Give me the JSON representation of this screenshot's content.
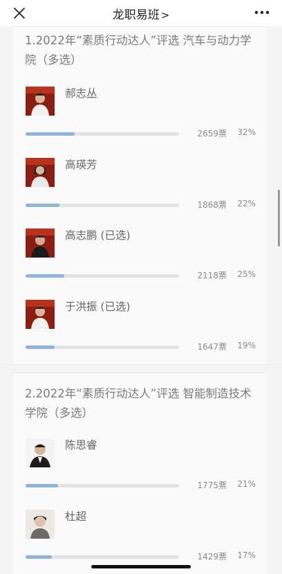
{
  "header": {
    "title": "龙职易班",
    "chevron": ">"
  },
  "colors": {
    "bar_fill": "#8fb3d9",
    "bar_track": "#e3e3e3",
    "background": "#f5f5f5"
  },
  "questions": [
    {
      "title": "1.2022年“素质行动达人”评选 汽车与动力学院（多选）",
      "options": [
        {
          "name": "郝志丛",
          "votes": "2659票",
          "percent": "32%",
          "fraction": 0.32
        },
        {
          "name": "高瑛芳",
          "votes": "1868票",
          "percent": "22%",
          "fraction": 0.22
        },
        {
          "name": "高志鹏 (已选)",
          "votes": "2118票",
          "percent": "25%",
          "fraction": 0.25
        },
        {
          "name": "于洪振 (已选)",
          "votes": "1647票",
          "percent": "19%",
          "fraction": 0.19
        }
      ]
    },
    {
      "title": "2.2022年“素质行动达人”评选 智能制造技术学院（多选）",
      "options": [
        {
          "name": "陈思睿",
          "votes": "1775票",
          "percent": "21%",
          "fraction": 0.21
        },
        {
          "name": "杜超",
          "votes": "1429票",
          "percent": "17%",
          "fraction": 0.17
        }
      ]
    }
  ]
}
